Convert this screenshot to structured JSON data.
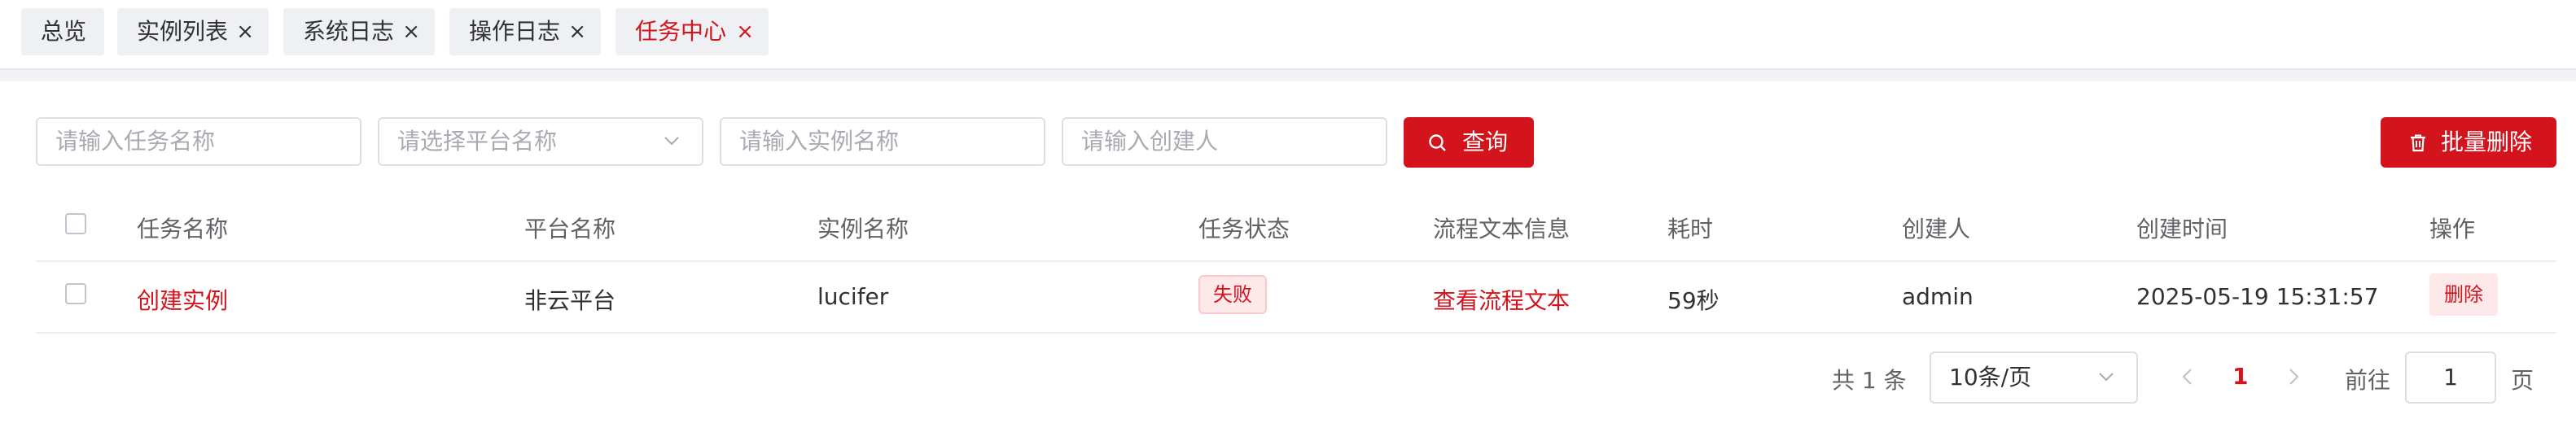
{
  "tabs": [
    {
      "label": "总览",
      "closable": false,
      "active": false
    },
    {
      "label": "实例列表",
      "closable": true,
      "active": false
    },
    {
      "label": "系统日志",
      "closable": true,
      "active": false
    },
    {
      "label": "操作日志",
      "closable": true,
      "active": false
    },
    {
      "label": "任务中心",
      "closable": true,
      "active": true
    }
  ],
  "close_glyph": "×",
  "filters": {
    "task_name_placeholder": "请输入任务名称",
    "platform_placeholder": "请选择平台名称",
    "instance_placeholder": "请输入实例名称",
    "creator_placeholder": "请输入创建人",
    "query_label": "查询",
    "batch_delete_label": "批量删除"
  },
  "table": {
    "columns": [
      "任务名称",
      "平台名称",
      "实例名称",
      "任务状态",
      "流程文本信息",
      "耗时",
      "创建人",
      "创建时间",
      "操作"
    ],
    "rows": [
      {
        "task_name": "创建实例",
        "platform": "非云平台",
        "instance": "lucifer",
        "status": "失败",
        "flow_text": "查看流程文本",
        "duration": "59秒",
        "creator": "admin",
        "created_at": "2025-05-19 15:31:57",
        "action": "删除"
      }
    ]
  },
  "pagination": {
    "total_text": "共 1 条",
    "page_size": "10条/页",
    "current_page": "1",
    "goto_label": "前往",
    "goto_value": "1",
    "page_suffix": "页"
  },
  "colors": {
    "accent": "#d4141d",
    "status_fail_bg": "#fde9ea"
  }
}
